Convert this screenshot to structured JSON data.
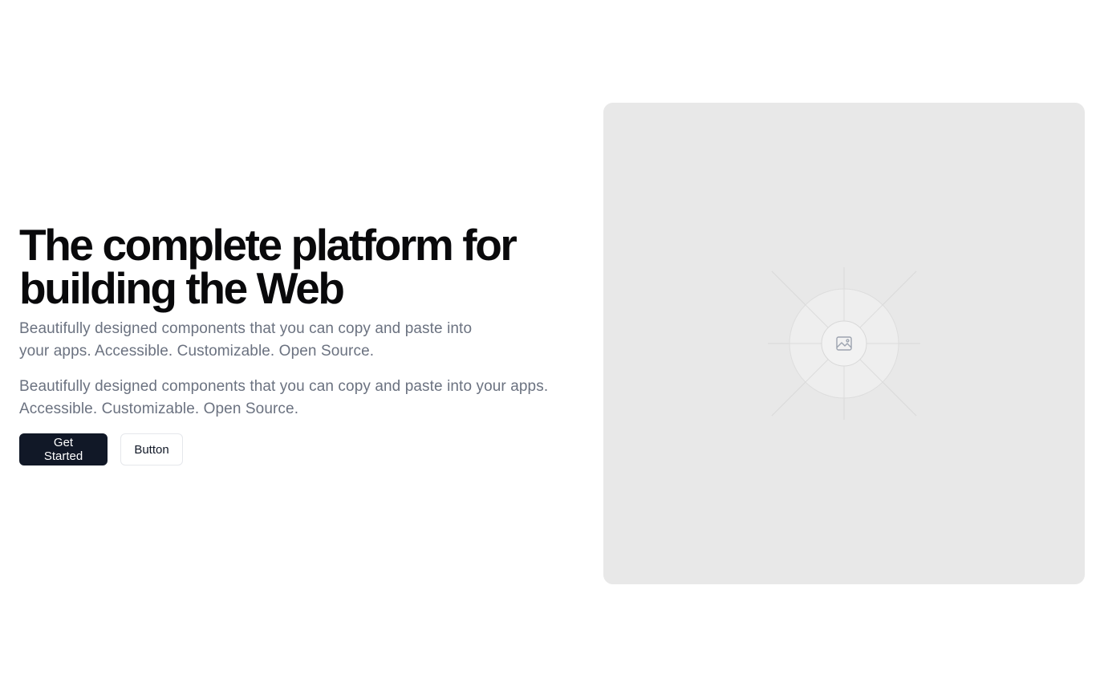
{
  "hero": {
    "headline": "The complete platform for building the Web",
    "subtext_primary": "Beautifully designed components that you can copy and paste into your apps. Accessible. Customizable. Open Source.",
    "subtext_secondary": "Beautifully designed components that you can copy and paste into your apps. Accessible. Customizable. Open Source."
  },
  "actions": {
    "primary_label": "Get Started",
    "secondary_label": "Button"
  },
  "media": {
    "placeholder_icon": "image-icon"
  },
  "colors": {
    "primary_button": "#111827",
    "placeholder_bg": "#e8e8e8",
    "muted_text": "#6b7280"
  }
}
